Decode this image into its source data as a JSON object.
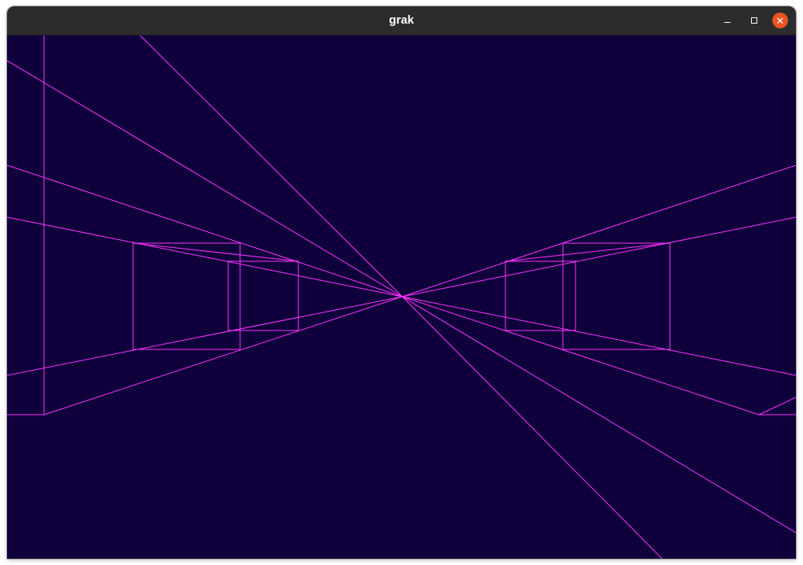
{
  "window": {
    "title": "grak",
    "controls": {
      "minimize_icon": "minimize-icon",
      "maximize_icon": "maximize-icon",
      "close_icon": "close-icon"
    },
    "close_color": "#e95420",
    "titlebar_color": "#2c2c2c"
  },
  "viewport": {
    "background_color": "#0f003b",
    "line_color": "#ff33ff"
  }
}
